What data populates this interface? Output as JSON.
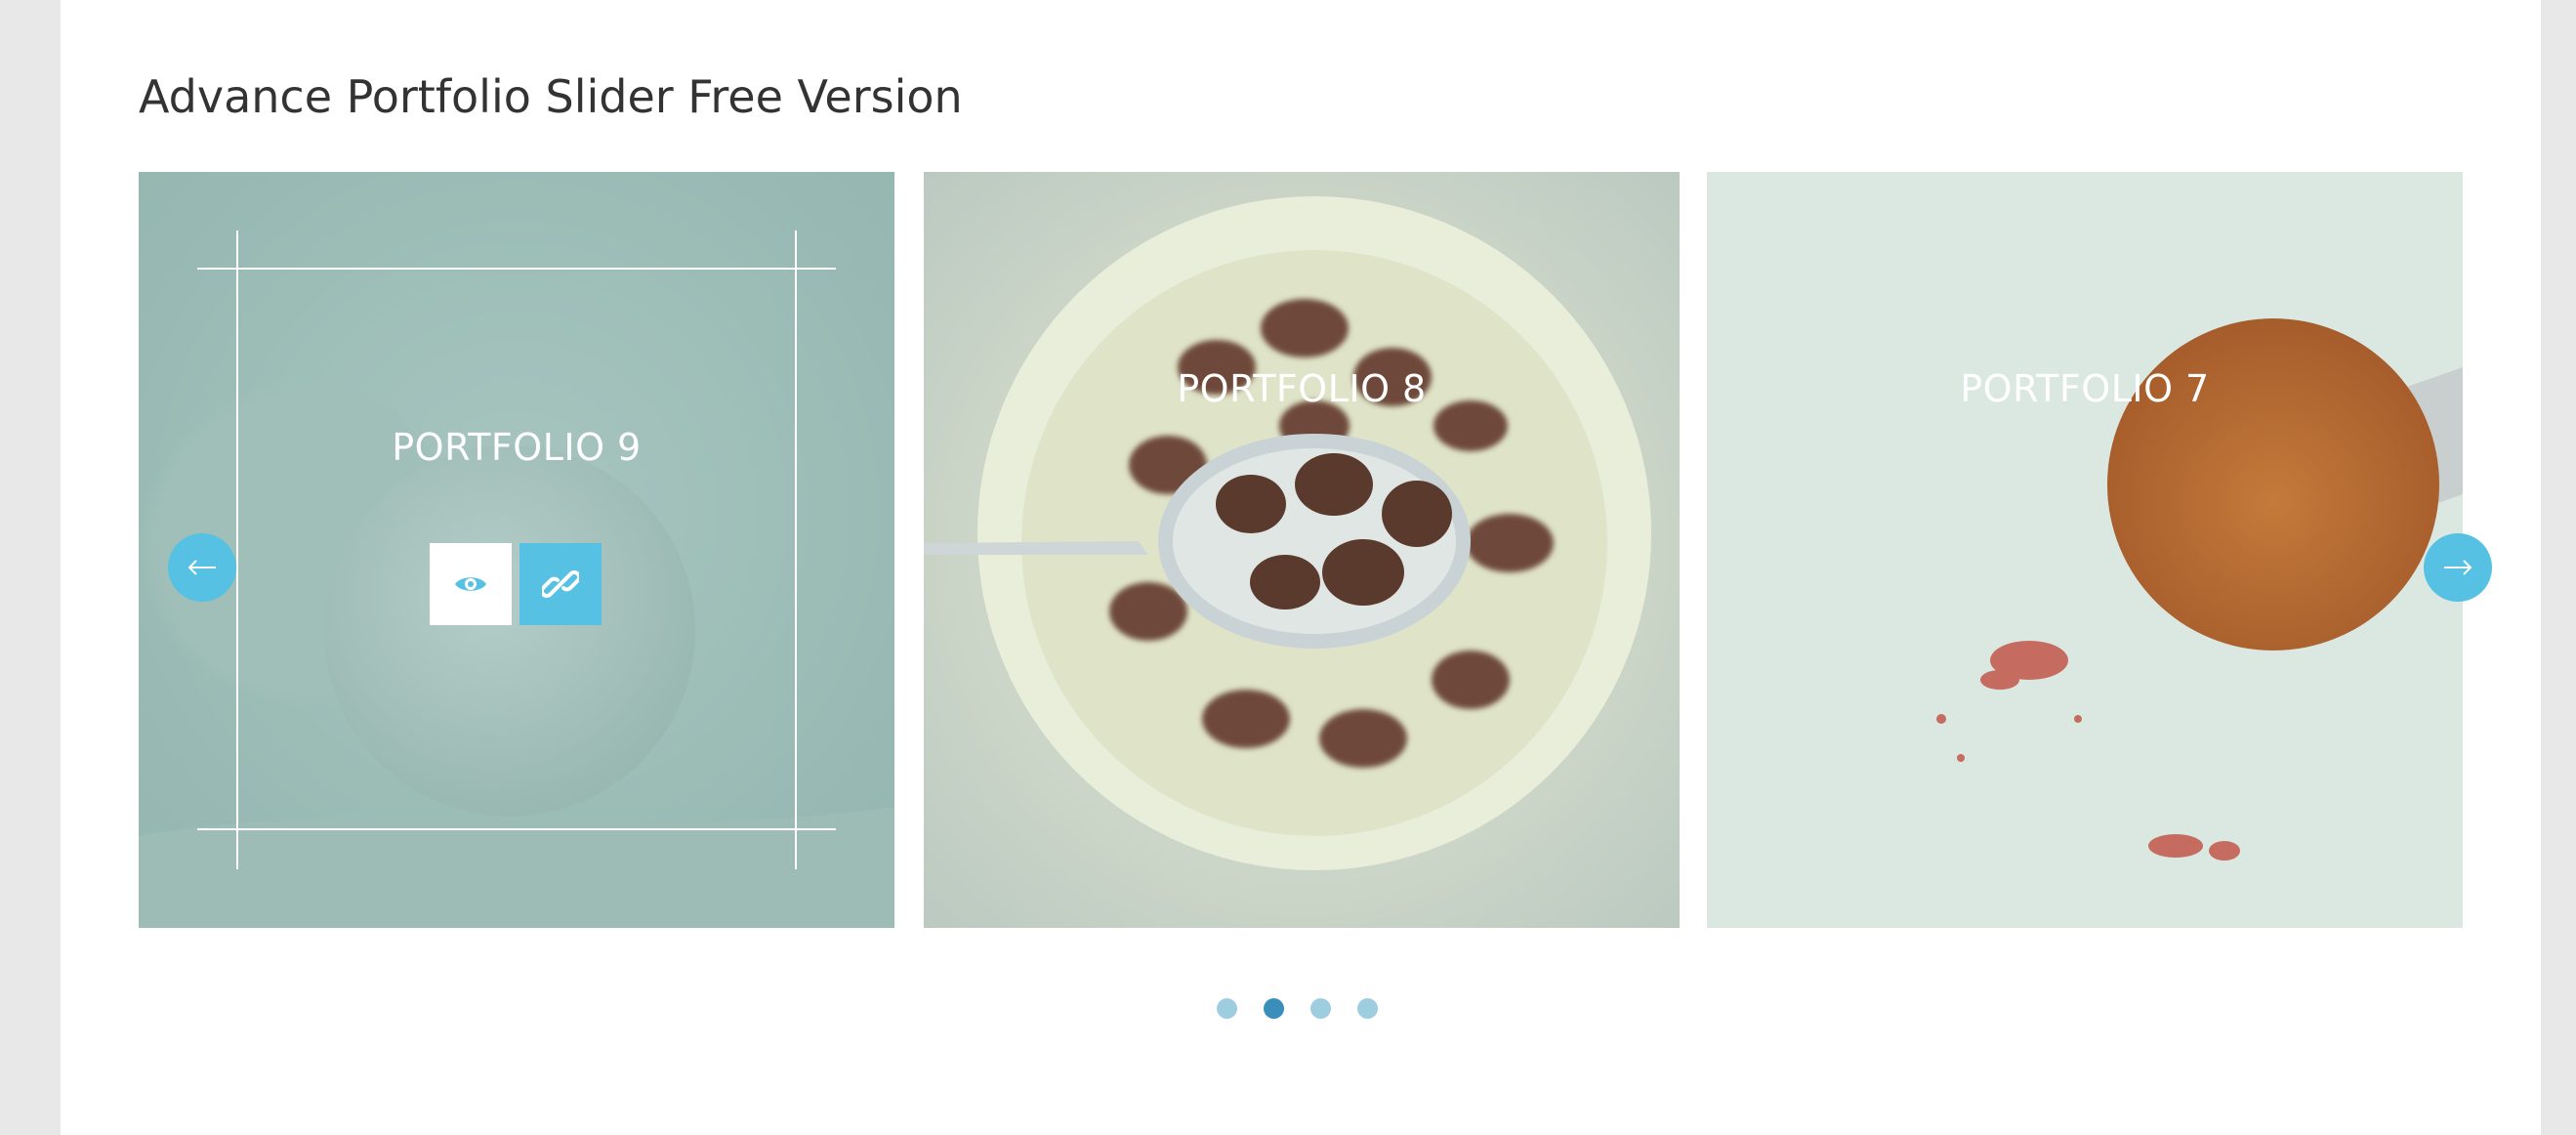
{
  "page": {
    "title": "Advance Portfolio Slider Free Version"
  },
  "slides": [
    {
      "label": "PORTFOLIO 9",
      "image": "yarn-ball-photo"
    },
    {
      "label": "PORTFOLIO 8",
      "image": "cereal-bowl-photo"
    },
    {
      "label": "PORTFOLIO 7",
      "image": "makeup-brush-photo"
    }
  ],
  "actions": {
    "view_icon": "eye-icon",
    "link_icon": "link-icon"
  },
  "navigation": {
    "prev_icon": "arrow-left-icon",
    "next_icon": "arrow-right-icon"
  },
  "pagination": {
    "count": 4,
    "active_index": 1
  },
  "colors": {
    "accent": "#56c1e3",
    "dot": "#9fcde0",
    "dot_active": "#3a8fba",
    "title": "#333333"
  }
}
